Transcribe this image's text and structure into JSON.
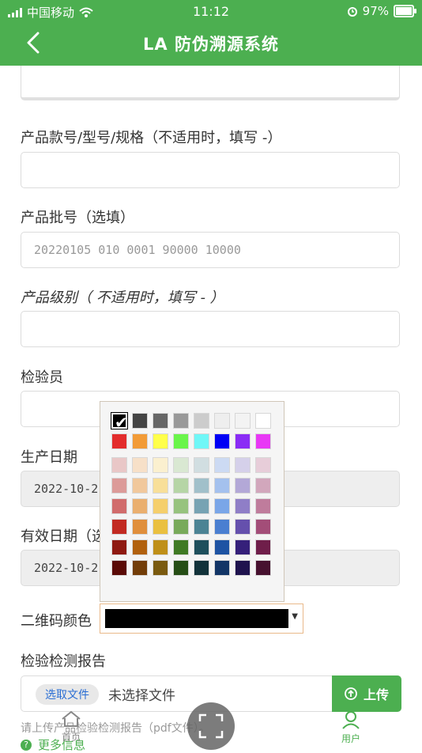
{
  "status_bar": {
    "carrier": "中国移动",
    "time": "11:12",
    "battery": "97%"
  },
  "header": {
    "title": "LA 防伪溯源系统"
  },
  "fields": {
    "model_label": "产品款号/型号/规格（不适用时，填写 -）",
    "batch_label": "产品批号（选填）",
    "batch_placeholder": "20220105 010 0001 90000 10000",
    "level_label": "产品级别（ 不适用时，填写 - ）",
    "inspector_label": "检验员",
    "prod_date_label": "生产日期",
    "prod_date_value": "2022-10-2",
    "expire_label": "有效日期（选",
    "expire_value": "2022-10-2",
    "qr_color_label": "二维码颜色",
    "report_label": "检验检测报告"
  },
  "upload": {
    "choose_label": "选取文件",
    "no_file_text": "未选择文件",
    "upload_label": "上传",
    "hint": "请上传产品检验检测报告（pdf文件）。"
  },
  "more": {
    "label": "更多信息"
  },
  "tabbar": {
    "home_label": "首页",
    "user_label": "用户"
  },
  "palette": {
    "selected": "#000000",
    "rows": [
      [
        "#000000",
        "#444444",
        "#666666",
        "#999999",
        "#cccccc",
        "#eeeeee",
        "#f3f3f3",
        "#ffffff"
      ],
      [
        "#e32d2d",
        "#f29b37",
        "#ffff4a",
        "#6af54a",
        "#70f7f7",
        "#0000f5",
        "#8a2cf5",
        "#e838f5"
      ],
      [
        "#e9c7c7",
        "#f7e0c8",
        "#fbf0cf",
        "#d9e8d2",
        "#d1dee1",
        "#ccdaf3",
        "#d5d0ea",
        "#e7cdd9"
      ],
      [
        "#dc9b99",
        "#f1c89c",
        "#f8df99",
        "#b6d5a6",
        "#a1c0ca",
        "#a4c1ee",
        "#b3a8d7",
        "#d2a7bc"
      ],
      [
        "#d16c6c",
        "#eaaf6f",
        "#f5cf6c",
        "#97c37e",
        "#77a3b3",
        "#7aa6e8",
        "#8f7ec7",
        "#bf7c9c"
      ],
      [
        "#c22a22",
        "#e08f3c",
        "#eac040",
        "#78aa5a",
        "#4b8394",
        "#4a7fd1",
        "#6550ad",
        "#a34d78"
      ],
      [
        "#8f1a12",
        "#b1610e",
        "#bf8f18",
        "#3f7a24",
        "#1e4f5c",
        "#1e53a3",
        "#35207a",
        "#6f1e4a"
      ],
      [
        "#5a0a06",
        "#723d08",
        "#7a5a0f",
        "#264e16",
        "#12323a",
        "#123566",
        "#1f134e",
        "#47112f"
      ]
    ]
  }
}
